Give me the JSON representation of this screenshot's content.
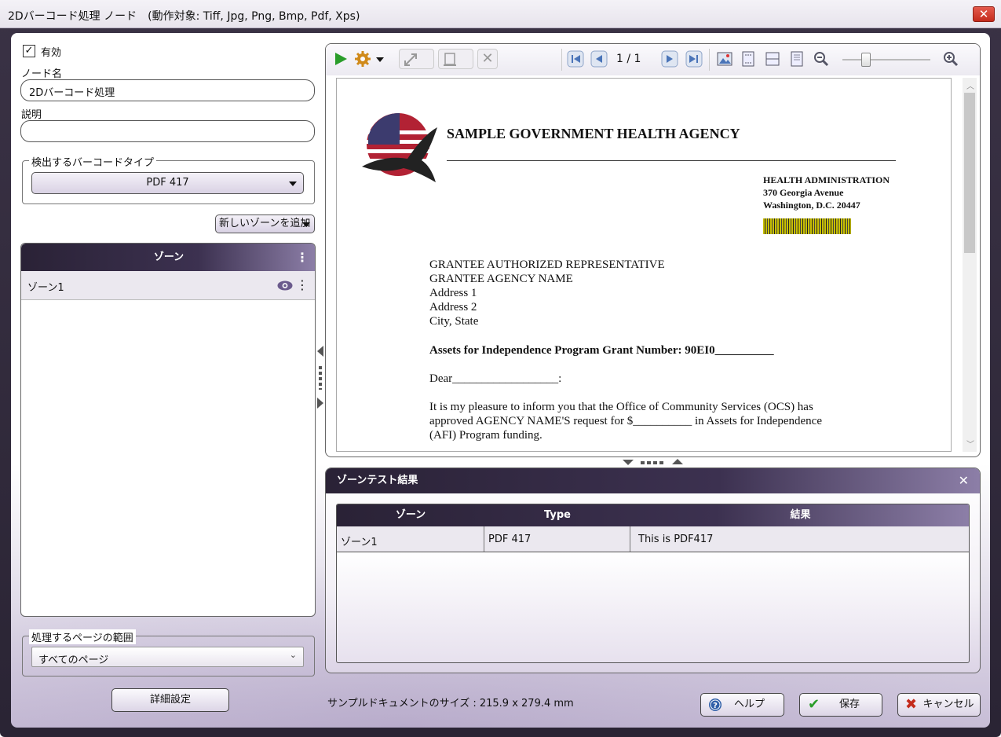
{
  "window": {
    "title": "2Dバーコード処理 ノード　(動作対象: Tiff, Jpg, Png, Bmp, Pdf, Xps)"
  },
  "left": {
    "enabled_label": "有効",
    "node_name_label": "ノード名",
    "node_name_value": "2Dバーコード処理",
    "description_label": "説明",
    "description_value": "",
    "barcode_type_group": "検出するバーコードタイプ",
    "barcode_type_value": "PDF 417",
    "add_zone_button": "新しいゾーンを追加",
    "zones_header": "ゾーン",
    "zones": [
      {
        "name": "ゾーン1"
      }
    ],
    "page_range_group": "処理するページの範囲",
    "page_range_value": "すべてのページ",
    "advanced_button": "詳細設定"
  },
  "viewer": {
    "page_indicator": "1 / 1",
    "document": {
      "agency_title": "SAMPLE GOVERNMENT HEALTH AGENCY",
      "admin_lines": [
        "HEALTH ADMINISTRATION",
        "370 Georgia Avenue",
        "Washington, D.C. 20447"
      ],
      "address_lines": [
        "GRANTEE AUTHORIZED REPRESENTATIVE",
        "GRANTEE AGENCY NAME",
        "Address 1",
        "Address 2",
        "City, State"
      ],
      "grant_line": "Assets for Independence Program Grant Number:  90EI0__________",
      "dear_line": "Dear__________________:",
      "body_lines": [
        "It is my pleasure to inform you that the Office of Community Services (OCS) has",
        "approved AGENCY NAME'S  request for $__________ in Assets for Independence",
        "(AFI) Program funding."
      ]
    }
  },
  "results": {
    "title": "ゾーンテスト結果",
    "columns": [
      "ゾーン",
      "Type",
      "結果"
    ],
    "rows": [
      [
        "ゾーン1",
        "PDF 417",
        "This is PDF417"
      ]
    ]
  },
  "footer": {
    "sample_size": "サンプルドキュメントのサイズ : 215.9 x 279.4 mm",
    "help_button": "ヘルプ",
    "save_button": "保存",
    "cancel_button": "キャンセル"
  },
  "colors": {
    "header_dark": "#2a2236",
    "accent_purple": "#8d7fa8",
    "play_green": "#2a9d2a",
    "barcode_yellow": "#c8c000"
  }
}
